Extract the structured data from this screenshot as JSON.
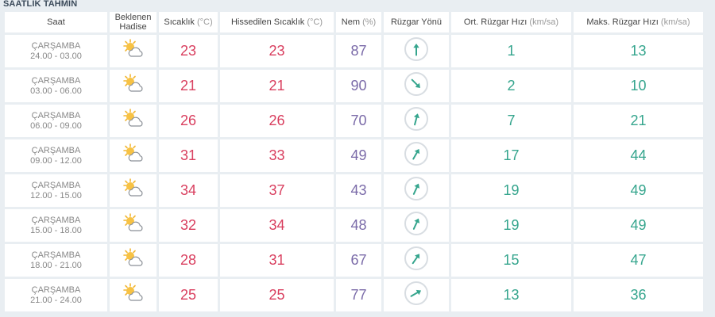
{
  "section_title": "SAATLİK TAHMİN",
  "headers": {
    "saat": "Saat",
    "hadise": "Beklenen Hadise",
    "sicaklik": "Sıcaklık",
    "sicaklik_unit": "(°C)",
    "hissedilen": "Hissedilen Sıcaklık",
    "hissedilen_unit": "(°C)",
    "nem": "Nem",
    "nem_unit": "(%)",
    "ruzgar_yonu": "Rüzgar Yönü",
    "ort_ruzgar": "Ort. Rüzgar Hızı",
    "ort_ruzgar_unit": "(km/sa)",
    "maks_ruzgar": "Maks. Rüzgar Hızı",
    "maks_ruzgar_unit": "(km/sa)"
  },
  "rows": [
    {
      "day": "ÇARŞAMBA",
      "range": "24.00 - 03.00",
      "icon": "partly-cloudy-icon",
      "temp": "23",
      "feels": "23",
      "humidity": "87",
      "wind_dir_deg": 180,
      "wind_avg": "1",
      "wind_max": "13"
    },
    {
      "day": "ÇARŞAMBA",
      "range": "03.00 - 06.00",
      "icon": "partly-cloudy-icon",
      "temp": "21",
      "feels": "21",
      "humidity": "90",
      "wind_dir_deg": 315,
      "wind_avg": "2",
      "wind_max": "10"
    },
    {
      "day": "ÇARŞAMBA",
      "range": "06.00 - 09.00",
      "icon": "partly-cloudy-icon",
      "temp": "26",
      "feels": "26",
      "humidity": "70",
      "wind_dir_deg": 195,
      "wind_avg": "7",
      "wind_max": "21"
    },
    {
      "day": "ÇARŞAMBA",
      "range": "09.00 - 12.00",
      "icon": "partly-cloudy-icon",
      "temp": "31",
      "feels": "33",
      "humidity": "49",
      "wind_dir_deg": 210,
      "wind_avg": "17",
      "wind_max": "44"
    },
    {
      "day": "ÇARŞAMBA",
      "range": "12.00 - 15.00",
      "icon": "partly-cloudy-icon",
      "temp": "34",
      "feels": "37",
      "humidity": "43",
      "wind_dir_deg": 205,
      "wind_avg": "19",
      "wind_max": "49"
    },
    {
      "day": "ÇARŞAMBA",
      "range": "15.00 - 18.00",
      "icon": "partly-cloudy-icon",
      "temp": "32",
      "feels": "34",
      "humidity": "48",
      "wind_dir_deg": 205,
      "wind_avg": "19",
      "wind_max": "49"
    },
    {
      "day": "ÇARŞAMBA",
      "range": "18.00 - 21.00",
      "icon": "partly-cloudy-icon",
      "temp": "28",
      "feels": "31",
      "humidity": "67",
      "wind_dir_deg": 215,
      "wind_avg": "15",
      "wind_max": "47"
    },
    {
      "day": "ÇARŞAMBA",
      "range": "21.00 - 24.00",
      "icon": "partly-cloudy-icon",
      "temp": "25",
      "feels": "25",
      "humidity": "77",
      "wind_dir_deg": 240,
      "wind_avg": "13",
      "wind_max": "36"
    }
  ],
  "colors": {
    "temp": "#d93f5f",
    "humidity": "#7a6aa8",
    "wind": "#35a58d",
    "arrow": "#35a58d"
  }
}
